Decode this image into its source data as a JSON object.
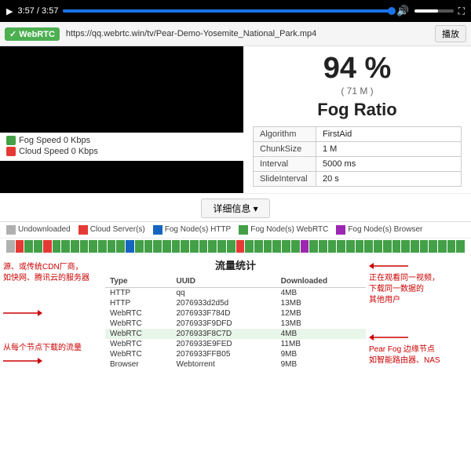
{
  "player": {
    "time": "3:57 / 3:57",
    "play_icon": "▶"
  },
  "webrtc": {
    "badge": "✓ WebRTC",
    "url": "https://qq.webrtc.win/tv/Pear-Demo-Yosemite_National_Park.mp4",
    "play_btn": "播放"
  },
  "stats": {
    "percentage": "94 %",
    "size": "( 71 M )",
    "title": "Fog Ratio",
    "table": [
      {
        "label": "Algorithm",
        "value": "FirstAid"
      },
      {
        "label": "ChunkSize",
        "value": "1 M"
      },
      {
        "label": "Interval",
        "value": "5000 ms"
      },
      {
        "label": "SlideInterval",
        "value": "20 s"
      }
    ]
  },
  "details_btn": "详细信息 ▾",
  "legend": {
    "items": [
      {
        "label": "Undownloaded",
        "color": "#b0b0b0"
      },
      {
        "label": "Cloud Server(s)",
        "color": "#e53935"
      },
      {
        "label": "Fog Node(s) HTTP",
        "color": "#1565c0"
      },
      {
        "label": "Fog Node(s) WebRTC",
        "color": "#43a047"
      },
      {
        "label": "Fog Node(s) Browser",
        "color": "#9c27b0"
      }
    ]
  },
  "left_legend": [
    {
      "label": "Fog Speed 0 Kbps",
      "color": "#43a047"
    },
    {
      "label": "Cloud Speed 0 Kbps",
      "color": "#e53935"
    }
  ],
  "chunks": {
    "colors": [
      "#b0b0b0",
      "#e53935",
      "#43a047",
      "#43a047",
      "#e53935",
      "#43a047",
      "#43a047",
      "#43a047",
      "#43a047",
      "#43a047",
      "#43a047",
      "#43a047",
      "#43a047",
      "#1565c0",
      "#43a047",
      "#43a047",
      "#43a047",
      "#43a047",
      "#43a047",
      "#43a047",
      "#43a047",
      "#43a047",
      "#43a047",
      "#43a047",
      "#43a047",
      "#e53935",
      "#43a047",
      "#43a047",
      "#43a047",
      "#43a047",
      "#43a047",
      "#43a047",
      "#9c27b0",
      "#43a047",
      "#43a047",
      "#43a047",
      "#43a047",
      "#43a047",
      "#43a047",
      "#43a047",
      "#43a047",
      "#43a047",
      "#43a047",
      "#43a047",
      "#43a047",
      "#43a047",
      "#43a047",
      "#43a047",
      "#43a047",
      "#43a047"
    ]
  },
  "flow": {
    "title": "流量统计",
    "headers": [
      "Type",
      "UUID",
      "Downloaded"
    ],
    "rows": [
      {
        "type": "HTTP",
        "uuid": "qq",
        "downloaded": "4MB",
        "highlight": false
      },
      {
        "type": "HTTP",
        "uuid": "2076933d2d5d",
        "downloaded": "13MB",
        "highlight": false
      },
      {
        "type": "WebRTC",
        "uuid": "2076933F784D",
        "downloaded": "12MB",
        "highlight": false
      },
      {
        "type": "WebRTC",
        "uuid": "2076933F9DFD",
        "downloaded": "13MB",
        "highlight": false
      },
      {
        "type": "WebRTC",
        "uuid": "2076933F8C7D",
        "downloaded": "4MB",
        "highlight": true
      },
      {
        "type": "WebRTC",
        "uuid": "2076933E9FED",
        "downloaded": "11MB",
        "highlight": false
      },
      {
        "type": "WebRTC",
        "uuid": "2076933FFB05",
        "downloaded": "9MB",
        "highlight": false
      },
      {
        "type": "Browser",
        "uuid": "Webtorrent",
        "downloaded": "9MB",
        "highlight": false
      }
    ]
  },
  "annotations": {
    "left_top": "源、或传统CDN厂商，\n如快网、腾讯云的服务器",
    "left_bottom": "从每个节点下载的流量",
    "right_top": "正在观看同一视频，\n下载同一数据的\n其他用户",
    "right_bottom": "Pear Fog 边缘节点\n如智能路由器、NAS"
  }
}
